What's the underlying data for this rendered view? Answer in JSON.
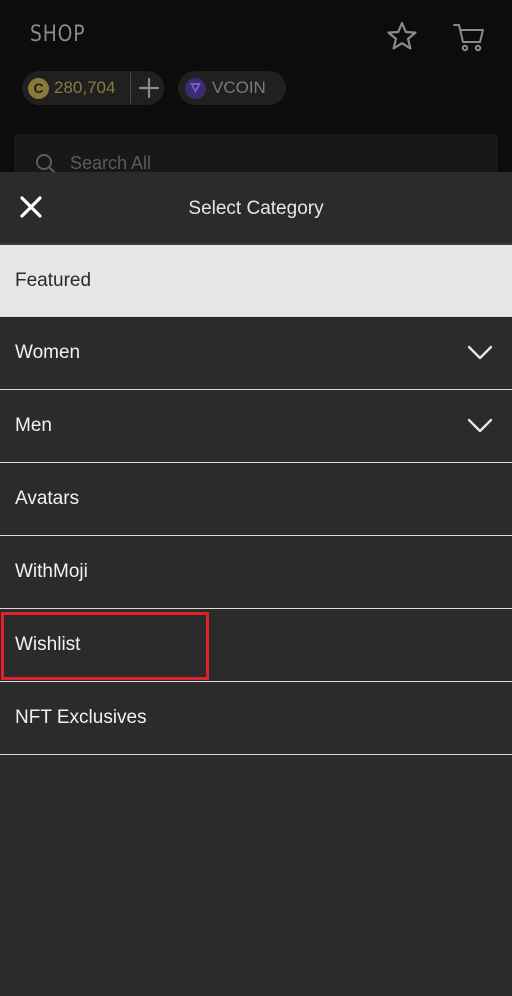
{
  "shop": {
    "title": "SHOP",
    "coins": {
      "amount": "280,704",
      "icon_glyph": "C"
    },
    "vcoin": {
      "label": "VCOIN"
    },
    "search": {
      "placeholder": "Search All"
    }
  },
  "sheet": {
    "title": "Select Category",
    "categories": [
      {
        "label": "Featured",
        "selected": true,
        "has_chevron": false
      },
      {
        "label": "Women",
        "selected": false,
        "has_chevron": true
      },
      {
        "label": "Men",
        "selected": false,
        "has_chevron": true
      },
      {
        "label": "Avatars",
        "selected": false,
        "has_chevron": false
      },
      {
        "label": "WithMoji",
        "selected": false,
        "has_chevron": false
      },
      {
        "label": "Wishlist",
        "selected": false,
        "has_chevron": false,
        "highlighted": true
      },
      {
        "label": "NFT Exclusives",
        "selected": false,
        "has_chevron": false
      }
    ]
  },
  "icons": {
    "header": [
      "star-icon",
      "cart-icon"
    ],
    "coin": "coin-icon",
    "add": "plus-icon",
    "vcoin": "vcoin-icon",
    "search": "search-icon",
    "close": "close-icon",
    "expand": "chevron-down-icon"
  },
  "colors": {
    "background": "#2b2b2b",
    "header_background": "#0c0c0c",
    "selected_row": "#e6e6e6",
    "highlight": "#e0202a",
    "coin_gold": "#8a7a3c",
    "vcoin_purple": "#3c2b70"
  }
}
